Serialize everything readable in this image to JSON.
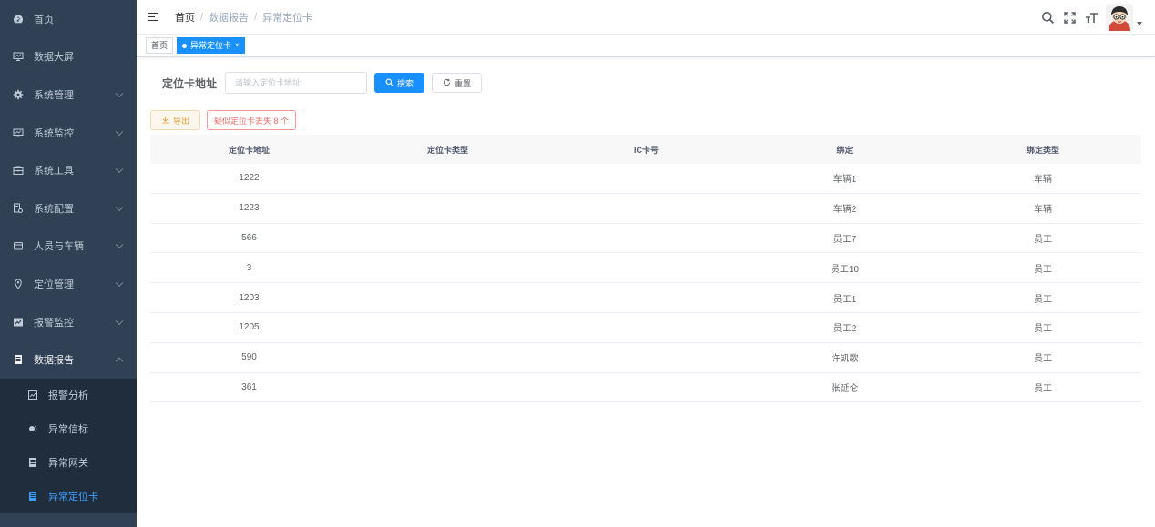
{
  "sidebar": {
    "items": [
      {
        "label": "首页",
        "icon": "dashboard-icon",
        "has_arrow": false
      },
      {
        "label": "数据大屏",
        "icon": "monitor-icon",
        "has_arrow": false
      },
      {
        "label": "系统管理",
        "icon": "gear-icon",
        "has_arrow": true
      },
      {
        "label": "系统监控",
        "icon": "monitor-icon",
        "has_arrow": true
      },
      {
        "label": "系统工具",
        "icon": "toolbox-icon",
        "has_arrow": true
      },
      {
        "label": "系统配置",
        "icon": "config-icon",
        "has_arrow": true
      },
      {
        "label": "人员与车辆",
        "icon": "card-icon",
        "has_arrow": true
      },
      {
        "label": "定位管理",
        "icon": "location-icon",
        "has_arrow": true
      },
      {
        "label": "报警监控",
        "icon": "alarm-icon",
        "has_arrow": true
      },
      {
        "label": "数据报告",
        "icon": "report-icon",
        "has_arrow": true
      }
    ],
    "subitems": [
      {
        "label": "报警分析",
        "icon": "chart-icon"
      },
      {
        "label": "异常信标",
        "icon": "beacon-icon"
      },
      {
        "label": "异常网关",
        "icon": "document-icon"
      },
      {
        "label": "异常定位卡",
        "icon": "document-icon"
      }
    ]
  },
  "navbar": {
    "breadcrumb": [
      "首页",
      "数据报告",
      "异常定位卡"
    ],
    "sep": "/"
  },
  "tags": {
    "home": "首页",
    "active": "异常定位卡",
    "close": "×"
  },
  "filter": {
    "label": "定位卡地址",
    "placeholder": "请输入定位卡地址",
    "search_label": "搜索",
    "reset_label": "重置"
  },
  "actions": {
    "export_label": "导出",
    "warning_label": "疑似定位卡丢失 8 个"
  },
  "table": {
    "headers": [
      "定位卡地址",
      "定位卡类型",
      "IC卡号",
      "绑定",
      "绑定类型"
    ],
    "rows": [
      [
        "1222",
        "",
        "",
        "车辆1",
        "车辆"
      ],
      [
        "1223",
        "",
        "",
        "车辆2",
        "车辆"
      ],
      [
        "566",
        "",
        "",
        "员工7",
        "员工"
      ],
      [
        "3",
        "",
        "",
        "员工10",
        "员工"
      ],
      [
        "1203",
        "",
        "",
        "员工1",
        "员工"
      ],
      [
        "1205",
        "",
        "",
        "员工2",
        "员工"
      ],
      [
        "590",
        "",
        "",
        "许凯歌",
        "员工"
      ],
      [
        "361",
        "",
        "",
        "张延仑",
        "员工"
      ]
    ]
  },
  "colors": {
    "sidebar_bg": "#304156",
    "submenu_bg": "#1f2d3d",
    "primary": "#1890ff",
    "active_text": "#409eff",
    "danger": "#f56c6c",
    "warning": "#e6a23c"
  }
}
